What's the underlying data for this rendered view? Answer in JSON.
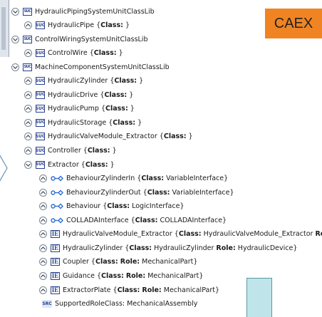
{
  "badge": {
    "label": "CAEX"
  },
  "tree": [
    {
      "id": "r1",
      "toggle": "down",
      "icon": "lib",
      "name": "HydraulicPipingSystemUnitClassLib",
      "cls": null,
      "role": null
    },
    {
      "id": "r2",
      "toggle": "up",
      "icon": "suc",
      "name": "HydraulicPipe",
      "cls": "",
      "role": null
    },
    {
      "id": "r3",
      "toggle": "down",
      "icon": "lib",
      "name": "ControlWiringSystemUnitClassLib",
      "cls": null,
      "role": null
    },
    {
      "id": "r4",
      "toggle": "up",
      "icon": "suc",
      "name": "ControlWire",
      "cls": "",
      "role": null
    },
    {
      "id": "r5",
      "toggle": "down",
      "icon": "lib",
      "name": "MachineComponentSystemUnitClassLib",
      "cls": null,
      "role": null
    },
    {
      "id": "r6",
      "toggle": "up",
      "icon": "suc",
      "name": "HydraulicZylinder",
      "cls": "",
      "role": null
    },
    {
      "id": "r7",
      "toggle": "up",
      "icon": "suc",
      "name": "HydraulicDrive",
      "cls": "",
      "role": null
    },
    {
      "id": "r8",
      "toggle": "up",
      "icon": "suc",
      "name": "HydraulicPump",
      "cls": "",
      "role": null
    },
    {
      "id": "r9",
      "toggle": "up",
      "icon": "suc",
      "name": "HydraulicStorage",
      "cls": "",
      "role": null
    },
    {
      "id": "r10",
      "toggle": "up",
      "icon": "suc",
      "name": "HydraulicValveModule_Extractor",
      "cls": "",
      "role": null
    },
    {
      "id": "r11",
      "toggle": "up",
      "icon": "suc",
      "name": "Controller",
      "cls": "",
      "role": null
    },
    {
      "id": "r12",
      "toggle": "down",
      "icon": "suc",
      "name": "Extractor",
      "cls": "",
      "role": null
    },
    {
      "id": "r13",
      "toggle": "up",
      "icon": "iface",
      "name": "BehaviourZylinderIn",
      "cls": "VariableInterface",
      "role": null
    },
    {
      "id": "r14",
      "toggle": "up",
      "icon": "iface",
      "name": "BehaviourZylinderOut",
      "cls": "VariableInterface",
      "role": null
    },
    {
      "id": "r15",
      "toggle": "up",
      "icon": "iface",
      "name": "Behaviour",
      "cls": "LogicInterface",
      "role": null
    },
    {
      "id": "r16",
      "toggle": "up",
      "icon": "iface",
      "name": "COLLADAInterface",
      "cls": "COLLADAInterface",
      "role": null
    },
    {
      "id": "r17",
      "toggle": "up",
      "icon": "ie",
      "name": "HydraulicValveModule_Extractor",
      "cls": "HydraulicValveModule_Extractor",
      "role": ""
    },
    {
      "id": "r18",
      "toggle": "up",
      "icon": "ie",
      "name": "HydraulicZylinder",
      "cls": "HydraulicZylinder",
      "role": "HydraulicDevice"
    },
    {
      "id": "r19",
      "toggle": "up",
      "icon": "ie",
      "name": "Coupler",
      "cls": "",
      "role": "MechanicalPart"
    },
    {
      "id": "r20",
      "toggle": "up",
      "icon": "ie",
      "name": "Guidance",
      "cls": "",
      "role": "MechanicalPart"
    },
    {
      "id": "r21",
      "toggle": "up",
      "icon": "ie",
      "name": "ExtractorPlate",
      "cls": "",
      "role": "MechanicalPart"
    },
    {
      "id": "r22",
      "toggle": null,
      "icon": "src",
      "name": "SupportedRoleClass: MechanicalAssembly",
      "cls": null,
      "role": null
    }
  ],
  "labels": {
    "class_kw": "Class:",
    "role_kw": "Role:"
  },
  "icon_text": {
    "lib": "SUC",
    "suc": "SUC",
    "ie": "IE",
    "src": "SRC"
  },
  "colors": {
    "accent": "#f08423",
    "icon": "#25418c",
    "interface": "#2f6fd0"
  }
}
